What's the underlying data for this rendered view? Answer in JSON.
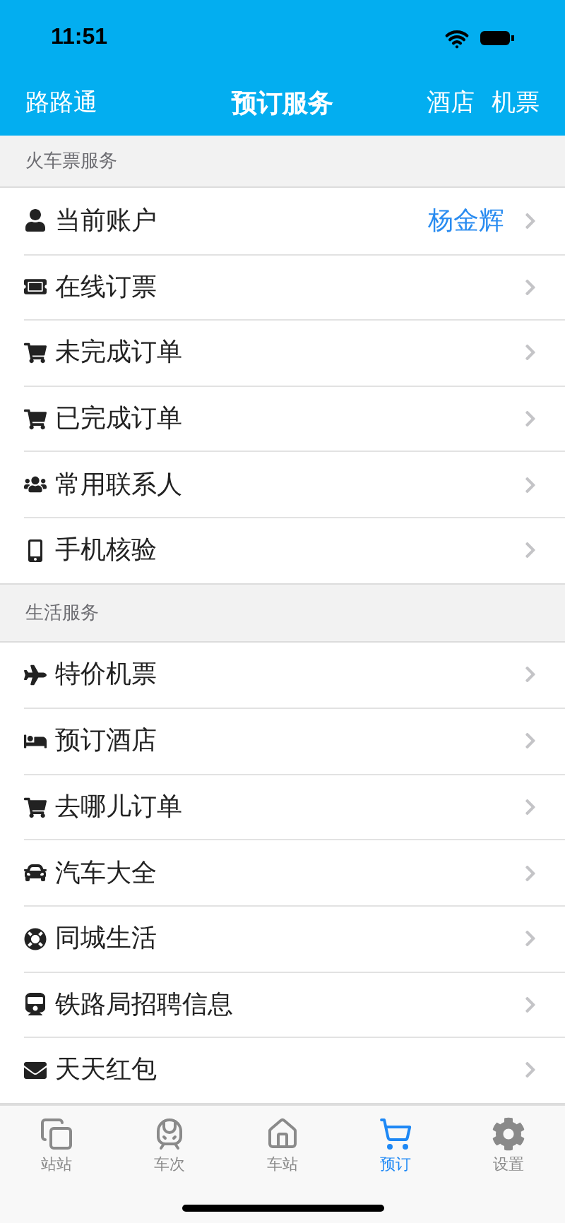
{
  "status_bar": {
    "time": "11:51"
  },
  "nav": {
    "left": "路路通",
    "title": "预订服务",
    "right": [
      "酒店",
      "机票"
    ]
  },
  "sections": [
    {
      "title": "火车票服务",
      "rows": [
        {
          "kind": "user",
          "label": "当前账户",
          "value": "杨金辉"
        },
        {
          "kind": "ticket",
          "label": "在线订票"
        },
        {
          "kind": "cart",
          "label": "未完成订单"
        },
        {
          "kind": "cart",
          "label": "已完成订单"
        },
        {
          "kind": "users",
          "label": "常用联系人"
        },
        {
          "kind": "phone",
          "label": "手机核验"
        }
      ]
    },
    {
      "title": "生活服务",
      "rows": [
        {
          "kind": "plane",
          "label": "特价机票"
        },
        {
          "kind": "bed",
          "label": "预订酒店"
        },
        {
          "kind": "cart",
          "label": "去哪儿订单"
        },
        {
          "kind": "car",
          "label": "汽车大全"
        },
        {
          "kind": "lifering",
          "label": "同城生活"
        },
        {
          "kind": "train",
          "label": "铁路局招聘信息"
        },
        {
          "kind": "envelope",
          "label": "天天红包"
        }
      ]
    }
  ],
  "tab_bar": [
    {
      "kind": "windows",
      "label": "站站",
      "selected": false
    },
    {
      "kind": "train",
      "label": "车次",
      "selected": false
    },
    {
      "kind": "home",
      "label": "车站",
      "selected": false
    },
    {
      "kind": "cart",
      "label": "预订",
      "selected": true
    },
    {
      "kind": "gear",
      "label": "设置",
      "selected": false
    }
  ]
}
